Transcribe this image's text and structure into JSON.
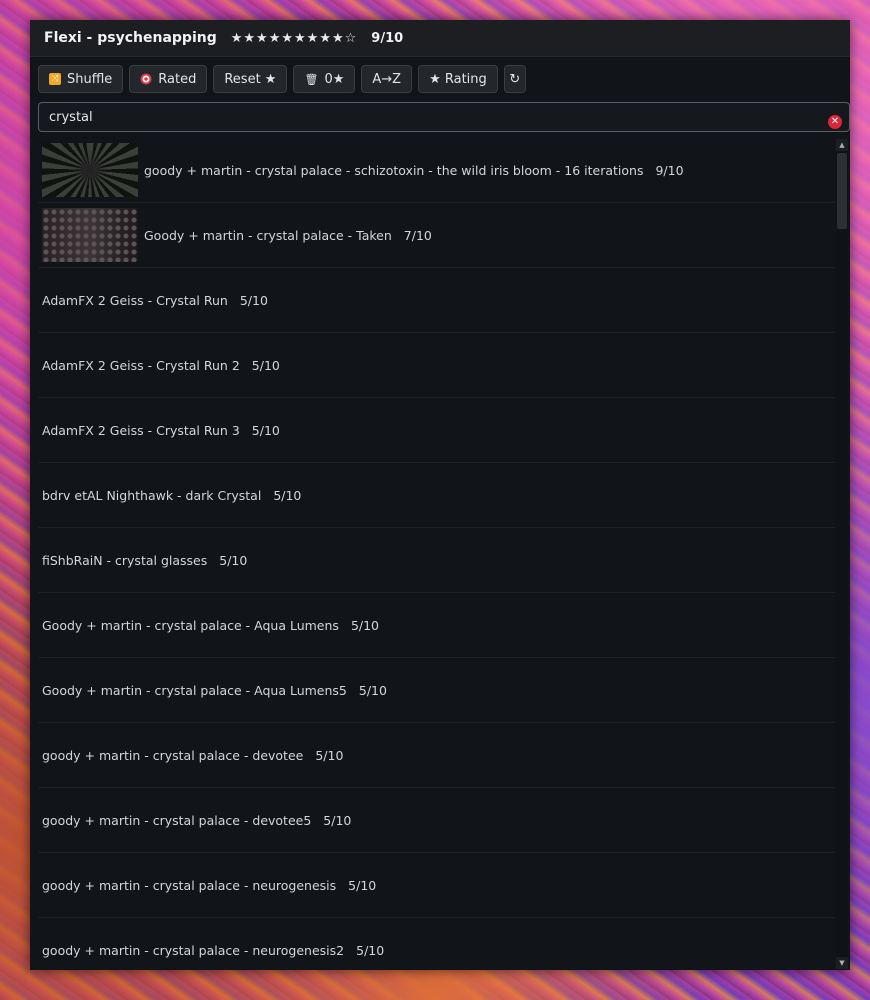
{
  "window": {
    "title": "Flexi - psychenapping",
    "stars": "★★★★★★★★★☆",
    "rating": "9/10"
  },
  "toolbar": {
    "shuffle": "Shuffle",
    "rated": "Rated",
    "reset": "Reset ★",
    "zero_star": "0★",
    "az": "A→Z",
    "rating_sort": "★ Rating",
    "refresh": "↻"
  },
  "search": {
    "value": "crystal"
  },
  "colors": {
    "accent": "#f5a623",
    "clear": "#d9263a",
    "background": "#111418"
  },
  "items": [
    {
      "name": "goody + martin - crystal palace - schizotoxin - the wild iris bloom - 16 iterations",
      "rating": "9/10"
    },
    {
      "name": "Goody + martin - crystal palace - Taken",
      "rating": "7/10"
    },
    {
      "name": "AdamFX 2 Geiss - Crystal Run",
      "rating": "5/10"
    },
    {
      "name": "AdamFX 2 Geiss - Crystal Run 2",
      "rating": "5/10"
    },
    {
      "name": "AdamFX 2 Geiss - Crystal Run 3",
      "rating": "5/10"
    },
    {
      "name": "bdrv etAL Nighthawk - dark Crystal",
      "rating": "5/10"
    },
    {
      "name": "fiShbRaiN - crystal glasses",
      "rating": "5/10"
    },
    {
      "name": "Goody + martin - crystal palace - Aqua Lumens",
      "rating": "5/10"
    },
    {
      "name": "Goody + martin - crystal palace - Aqua Lumens5",
      "rating": "5/10"
    },
    {
      "name": "goody + martin - crystal palace - devotee",
      "rating": "5/10"
    },
    {
      "name": "goody + martin - crystal palace - devotee5",
      "rating": "5/10"
    },
    {
      "name": "goody + martin - crystal palace - neurogenesis",
      "rating": "5/10"
    },
    {
      "name": "goody + martin - crystal palace - neurogenesis2",
      "rating": "5/10"
    }
  ]
}
